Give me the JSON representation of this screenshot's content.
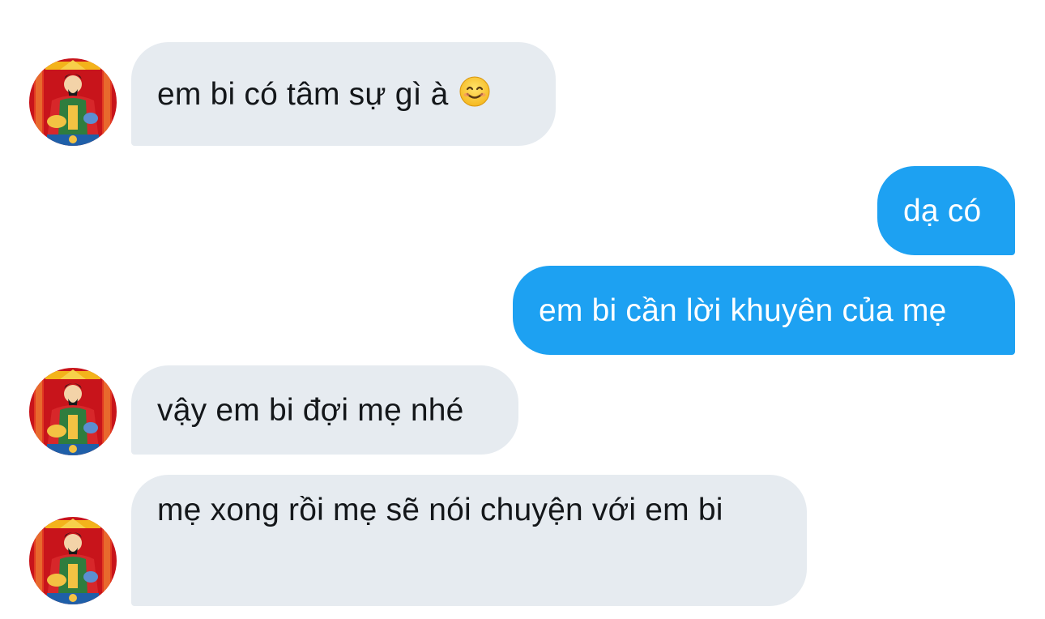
{
  "conversation": {
    "messages": [
      {
        "direction": "incoming",
        "text": "em bi có tâm sự gì à",
        "emoji": "smiling-face-icon"
      },
      {
        "direction": "outgoing",
        "text": "dạ có"
      },
      {
        "direction": "outgoing",
        "text": "em bi cần lời khuyên của mẹ"
      },
      {
        "direction": "incoming",
        "text": "vậy em bi đợi mẹ nhé"
      },
      {
        "direction": "incoming",
        "text": "mẹ xong rồi mẹ sẽ nói chuyện với em bi"
      }
    ]
  },
  "colors": {
    "incoming_bubble": "#e6ebf0",
    "outgoing_bubble": "#1da1f2",
    "incoming_text": "#14171a",
    "outgoing_text": "#ffffff"
  },
  "icons": {
    "avatar": "god-of-wealth-avatar-icon",
    "emoji": "smiling-face-icon"
  }
}
